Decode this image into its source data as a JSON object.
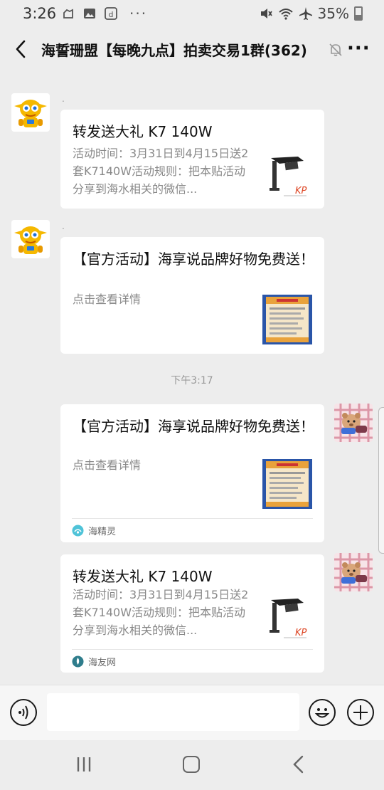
{
  "status_bar": {
    "time": "3:26",
    "battery": "35%",
    "icons": [
      "gesture-icon",
      "gallery-icon",
      "app-d-icon",
      "more-dots-icon",
      "mute-icon",
      "wifi-icon",
      "airplane-icon",
      "battery-icon"
    ]
  },
  "header": {
    "title": "海誓珊盟【每晚九点】拍卖交易1群(362)",
    "back_icon": "chevron-left-icon",
    "mute_icon": "bell-off-icon",
    "more_icon": "more-icon"
  },
  "messages": [
    {
      "sender_name": ".",
      "side": "left",
      "avatar": "cartoon-robot-avatar",
      "title": "转发送大礼 K7 140W",
      "description": "活动时间：3月31日到4月15日送2套K7140W活动规则：把本贴活动分享到海水相关的微信...",
      "thumbnail": "aquarium-lamp-thumbnail"
    },
    {
      "sender_name": ".",
      "side": "left",
      "avatar": "cartoon-robot-avatar",
      "title": "【官方活动】海享说品牌好物免费送！",
      "description": "点击查看详情",
      "thumbnail": "product-poster-thumbnail"
    },
    {
      "side": "right",
      "avatar": "plush-toy-avatar",
      "title": "【官方活动】海享说品牌好物免费送！",
      "description": "点击查看详情",
      "thumbnail": "product-poster-thumbnail",
      "source": "海精灵"
    },
    {
      "side": "right",
      "avatar": "plush-toy-avatar",
      "title": "转发送大礼 K7 140W",
      "description": "活动时间：3月31日到4月15日送2套K7140W活动规则：把本贴活动分享到海水相关的微信...",
      "thumbnail": "aquarium-lamp-thumbnail",
      "source": "海友网"
    }
  ],
  "timestamp": "下午3:17",
  "input_bar": {
    "voice_icon": "voice-icon",
    "emoji_icon": "emoji-icon",
    "plus_icon": "plus-icon",
    "value": ""
  },
  "nav_bar": {
    "icons": [
      "recents-icon",
      "home-icon",
      "back-icon"
    ]
  },
  "colors": {
    "background": "#ededed",
    "card": "#ffffff",
    "text_primary": "#111111",
    "text_secondary": "#888888"
  }
}
